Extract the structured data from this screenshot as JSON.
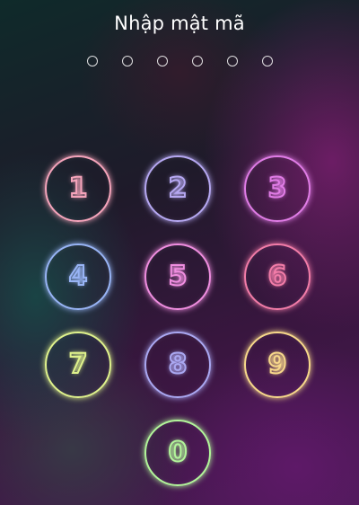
{
  "header": {
    "title": "Nhập mật mã"
  },
  "passcode": {
    "length": 6,
    "entered": 0
  },
  "keypad": {
    "keys": [
      {
        "label": "1",
        "color": "#f5a4bb"
      },
      {
        "label": "2",
        "color": "#b6a8f2"
      },
      {
        "label": "3",
        "color": "#e07ce6"
      },
      {
        "label": "4",
        "color": "#98b4f5"
      },
      {
        "label": "5",
        "color": "#f08ee0"
      },
      {
        "label": "6",
        "color": "#f27ca8"
      },
      {
        "label": "7",
        "color": "#dff28c"
      },
      {
        "label": "8",
        "color": "#aaa8f2"
      },
      {
        "label": "9",
        "color": "#f7d88a"
      },
      {
        "label": "0",
        "color": "#b2f59a"
      }
    ]
  }
}
